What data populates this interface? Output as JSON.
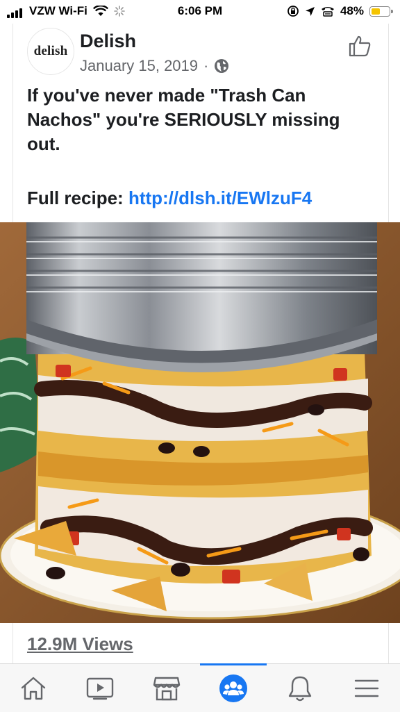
{
  "status_bar": {
    "carrier": "VZW Wi-Fi",
    "time": "6:06 PM",
    "battery": "48%",
    "battery_level": 0.48
  },
  "post": {
    "avatar_text": "delish",
    "page_name": "Delish",
    "date": "January 15, 2019",
    "separator": "·",
    "text": "If you've never made \"Trash Can Nachos\" you're SERIOUSLY missing out.",
    "recipe_label": "Full recipe:",
    "recipe_link": "http://dlsh.it/EWlzuF4",
    "views": "12.9M Views"
  },
  "tabs": [
    {
      "icon": "home-icon",
      "active": false
    },
    {
      "icon": "watch-icon",
      "active": false
    },
    {
      "icon": "marketplace-icon",
      "active": false
    },
    {
      "icon": "groups-icon",
      "active": true
    },
    {
      "icon": "notifications-icon",
      "active": false
    },
    {
      "icon": "menu-icon",
      "active": false
    }
  ],
  "colors": {
    "accent": "#1877f2",
    "battery": "#f5c400",
    "secondary_text": "#65676b"
  }
}
